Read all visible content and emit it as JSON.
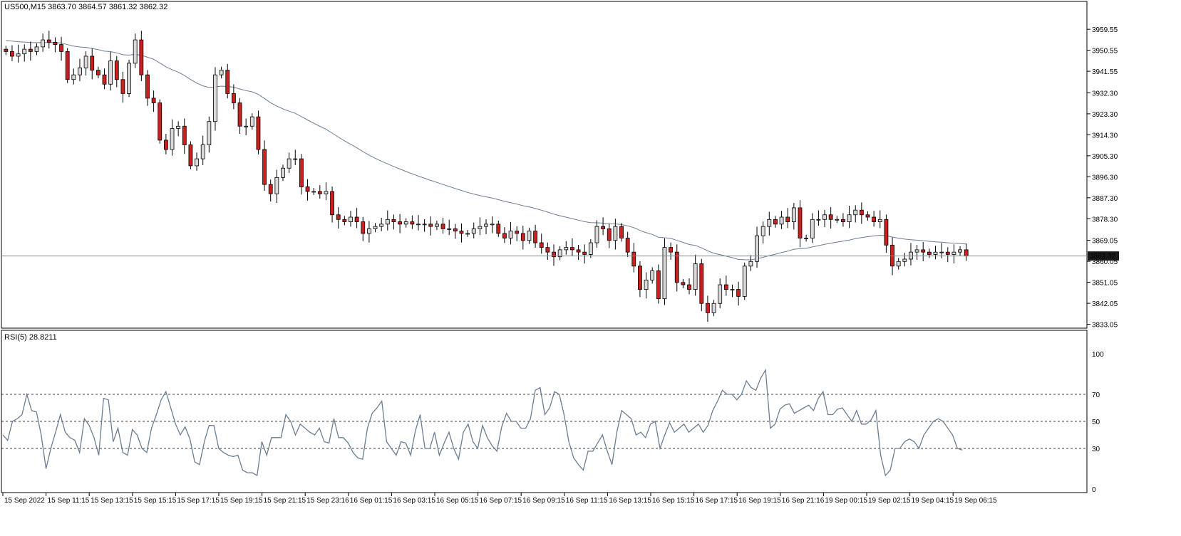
{
  "header": {
    "symbol_line": "US500,M15  3863.70 3864.57 3861.32 3862.32"
  },
  "price_badge": "3862.32",
  "rsi_title": "RSI(5) 28.8211",
  "colors": {
    "bull_fill": "#d9d9d9",
    "bear_fill": "#cc1f1f",
    "candle_outline": "#000000",
    "ma_line": "#6b7d93",
    "rsi_line": "#6b7d93",
    "price_line": "#7d8a9a",
    "badge_bg": "#1a1a1a"
  },
  "chart_data": [
    {
      "type": "candlestick",
      "title": "US500,M15",
      "ohlc_last": {
        "open": 3863.7,
        "high": 3864.57,
        "low": 3861.32,
        "close": 3862.32
      },
      "y_ticks": [
        "3959.55",
        "3950.55",
        "3941.55",
        "3932.30",
        "3923.30",
        "3914.30",
        "3905.30",
        "3896.30",
        "3887.30",
        "3878.30",
        "3869.05",
        "3860.05",
        "3851.05",
        "3842.05",
        "3833.05"
      ],
      "ylim": [
        3832.0,
        3966.0
      ],
      "current_price": 3862.32,
      "x_ticks": [
        "15 Sep 2022",
        "15 Sep 11:15",
        "15 Sep 13:15",
        "15 Sep 15:15",
        "15 Sep 17:15",
        "15 Sep 19:15",
        "15 Sep 21:15",
        "15 Sep 23:16",
        "16 Sep 01:15",
        "16 Sep 03:15",
        "16 Sep 05:15",
        "16 Sep 07:15",
        "16 Sep 09:15",
        "16 Sep 11:15",
        "16 Sep 13:15",
        "16 Sep 15:15",
        "16 Sep 17:15",
        "16 Sep 19:15",
        "16 Sep 21:16",
        "19 Sep 00:15",
        "19 Sep 02:15",
        "19 Sep 04:15",
        "19 Sep 06:15"
      ],
      "closes": [
        3950,
        3948,
        3949,
        3951,
        3950,
        3952,
        3955,
        3954,
        3953,
        3950,
        3938,
        3940,
        3943,
        3948,
        3942,
        3940,
        3936,
        3946,
        3938,
        3932,
        3945,
        3955,
        3940,
        3930,
        3928,
        3912,
        3908,
        3917,
        3918,
        3910,
        3901,
        3904,
        3910,
        3920,
        3940,
        3942,
        3932,
        3928,
        3918,
        3918,
        3922,
        3908,
        3893,
        3889,
        3896,
        3900,
        3904,
        3904,
        3892,
        3890,
        3890,
        3889,
        3890,
        3880,
        3878,
        3877,
        3879,
        3877,
        3872,
        3874,
        3875,
        3876,
        3878,
        3877,
        3876,
        3877,
        3876,
        3876,
        3876,
        3875,
        3876,
        3874,
        3874,
        3873,
        3872,
        3872,
        3874,
        3875,
        3876,
        3876,
        3872,
        3870,
        3873,
        3872,
        3869,
        3873,
        3868,
        3866,
        3864,
        3862,
        3865,
        3866,
        3865,
        3864,
        3863,
        3868,
        3875,
        3874,
        3869,
        3875,
        3870,
        3864,
        3858,
        3848,
        3852,
        3856,
        3844,
        3866,
        3864,
        3851,
        3850,
        3848,
        3859,
        3842,
        3838,
        3842,
        3850,
        3848,
        3848,
        3845,
        3858,
        3860,
        3871,
        3875,
        3878,
        3876,
        3879,
        3877,
        3883,
        3870,
        3870,
        3878,
        3878,
        3880,
        3878,
        3878,
        3877,
        3880,
        3882,
        3880,
        3879,
        3877,
        3878,
        3867,
        3858,
        3860,
        3861,
        3864,
        3865,
        3864,
        3863,
        3864,
        3864,
        3863,
        3864,
        3865,
        3862.32
      ],
      "ma_period_visual": "moving average overlay"
    },
    {
      "type": "line",
      "title": "RSI(5) 28.8211",
      "y_ticks": [
        "100",
        "70",
        "50",
        "30",
        "0"
      ],
      "ylim": [
        0,
        100
      ],
      "levels": [
        70,
        50,
        30
      ],
      "values": [
        40,
        36,
        50,
        52,
        55,
        70,
        58,
        57,
        40,
        15,
        30,
        42,
        55,
        42,
        38,
        36,
        27,
        52,
        47,
        38,
        25,
        67,
        66,
        35,
        45,
        27,
        25,
        44,
        40,
        30,
        27,
        45,
        55,
        66,
        72,
        60,
        48,
        40,
        46,
        37,
        20,
        18,
        35,
        47,
        47,
        30,
        27,
        25,
        24,
        25,
        14,
        12,
        12,
        10,
        35,
        25,
        38,
        38,
        38,
        55,
        50,
        40,
        48,
        45,
        42,
        40,
        45,
        35,
        34,
        52,
        38,
        38,
        34,
        27,
        23,
        22,
        45,
        56,
        60,
        65,
        35,
        30,
        25,
        35,
        34,
        25,
        43,
        55,
        30,
        30,
        42,
        25,
        34,
        42,
        30,
        22,
        42,
        48,
        35,
        30,
        47,
        38,
        32,
        28,
        46,
        56,
        50,
        50,
        45,
        45,
        52,
        73,
        75,
        55,
        60,
        72,
        70,
        55,
        35,
        23,
        18,
        14,
        28,
        28,
        34,
        40,
        28,
        18,
        42,
        58,
        55,
        52,
        40,
        42,
        38,
        48,
        50,
        30,
        40,
        49,
        42,
        45,
        48,
        42,
        45,
        48,
        42,
        47,
        58,
        65,
        73,
        70,
        70,
        66,
        70,
        80,
        75,
        73,
        82,
        88,
        45,
        48,
        59,
        62,
        63,
        56,
        58,
        60,
        62,
        58,
        67,
        72,
        55,
        55,
        59,
        60,
        55,
        50,
        58,
        48,
        48,
        51,
        58,
        25,
        10,
        14,
        30,
        30,
        35,
        37,
        35,
        30,
        40,
        45,
        50,
        52,
        50,
        45,
        40,
        30,
        28.82
      ]
    }
  ]
}
